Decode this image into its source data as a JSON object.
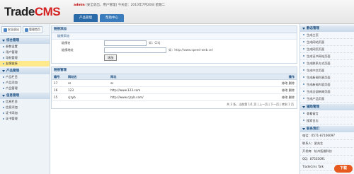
{
  "header": {
    "logo_main": "Trade",
    "logo_accent": "CMS",
    "user_name": "admin",
    "user_info": " [安全退出，用户管理] 今天是：2010年7月20日 星期二",
    "tabs": [
      "产品管理",
      "帮助中心"
    ]
  },
  "left": {
    "top_buttons": [
      "安全退出",
      "管理首页"
    ],
    "groups": [
      {
        "title": "综合管理",
        "items": [
          "参数设置",
          "用户管理",
          "导航管理",
          "友情链接"
        ],
        "active_index": 3
      },
      {
        "title": "产品管理",
        "items": [
          "产品栏目",
          "产品添加",
          "产品管理"
        ],
        "active_index": -1
      },
      {
        "title": "信息管理",
        "items": [
          "信息栏目",
          "信息添加",
          "证书添加",
          "证书管理"
        ],
        "active_index": -1
      }
    ]
  },
  "main": {
    "form_panel_title": "链接添加",
    "form_sub_title": "链接添加",
    "name_label": "链接名",
    "name_hint": "如：Cihj",
    "url_label": "链接地址",
    "url_hint": "如：http://www.speed-web.cn/",
    "submit_label": "增加",
    "list_panel_title": "链接管理",
    "columns": [
      "编号",
      "网站名",
      "网址",
      "操作"
    ],
    "rows": [
      {
        "id": "17",
        "name": "ss",
        "url": "ss",
        "ops": "修改 删除"
      },
      {
        "id": "16",
        "name": "123",
        "url": "http://www.123.com",
        "ops": "修改 删除"
      },
      {
        "id": "15",
        "name": "cjzyb",
        "url": "http://www.cjzyb.com/",
        "ops": "修改 删除"
      }
    ],
    "pager_text": "共 3 条，当前第 1/1 页 | 上一页 | 下一页 | 转到 1 页"
  },
  "right": {
    "groups": [
      {
        "title": "静态管理",
        "items": [
          "生成主页",
          "生成网站页面",
          "生成网页页面",
          "生成证书网站页面",
          "生成联系方式页面",
          "生成中文页面",
          "生成新闻列表页面",
          "生成新闻内容页面",
          "生成全部新闻页面",
          "生成产品页面"
        ]
      },
      {
        "title": "辅助管理",
        "items": [
          "查看留言",
          "搜索日志"
        ]
      }
    ],
    "contact_title": "联系我们",
    "contact_lines": [
      "电话：0571-87106097",
      "联系人：梁先生",
      "开发商：杭州拓维科技",
      "QQ：87535091",
      "TradeCms Talk"
    ],
    "watermark": "下载"
  }
}
